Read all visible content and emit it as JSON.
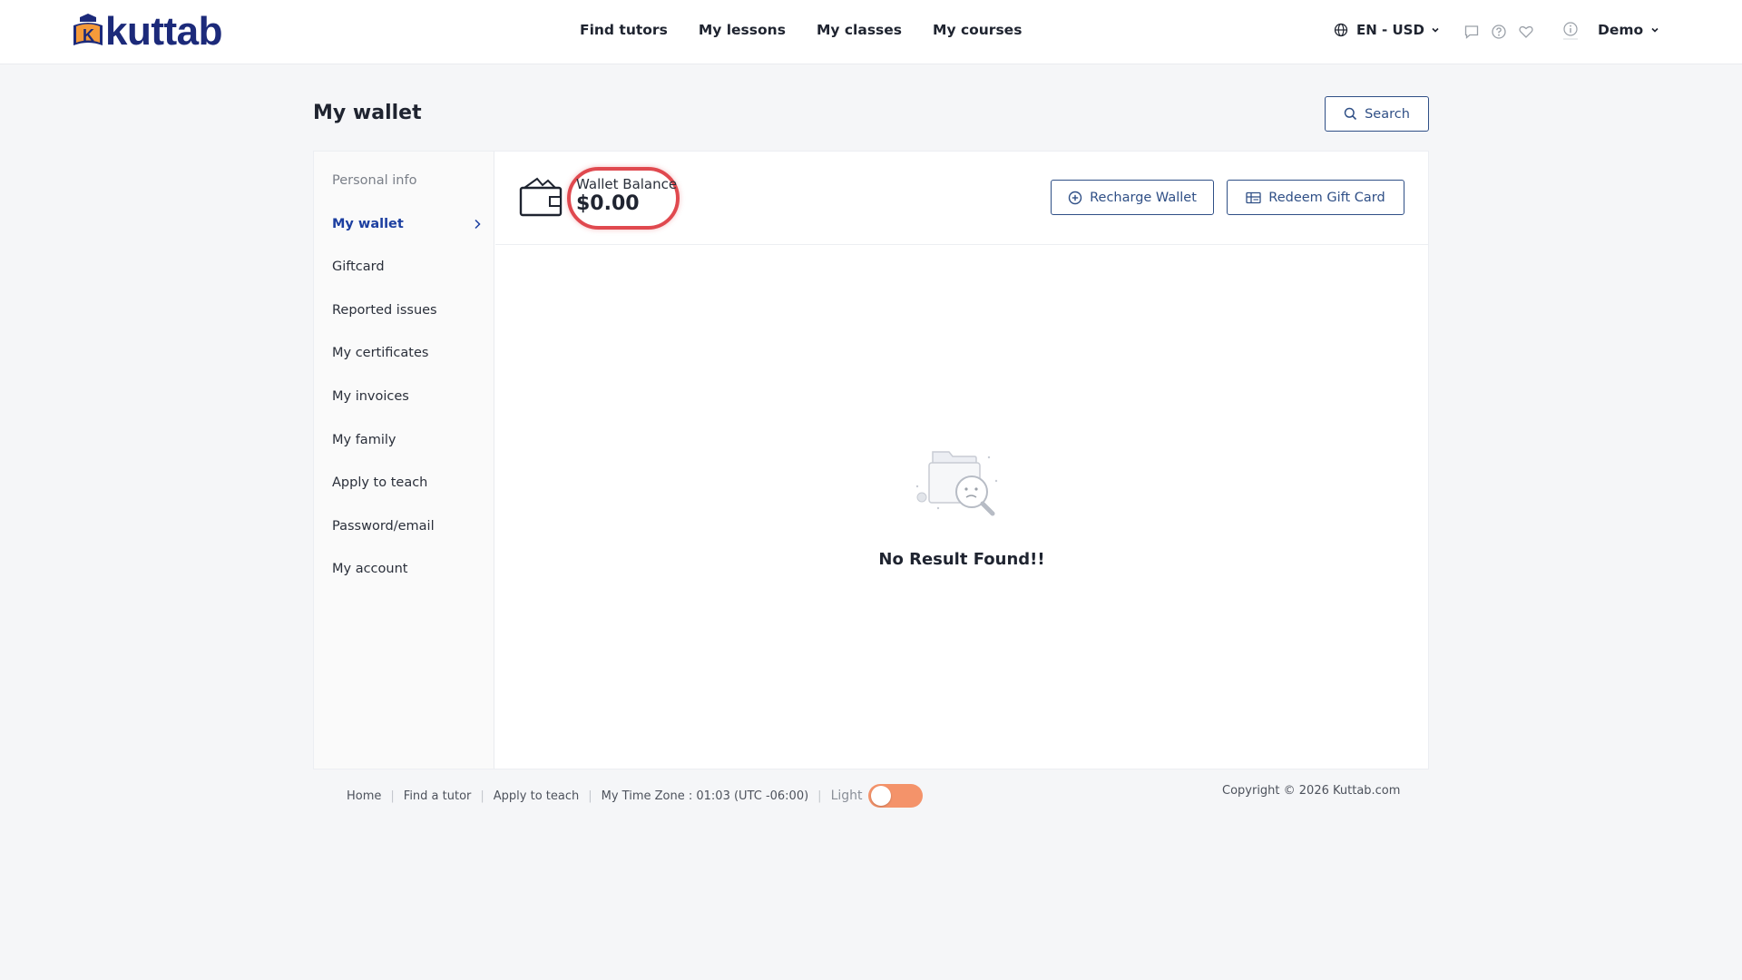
{
  "header": {
    "logo_text": "kuttab",
    "logo_letter": "K",
    "nav": [
      "Find tutors",
      "My lessons",
      "My classes",
      "My courses"
    ],
    "language_currency": "EN - USD",
    "user_name": "Demo"
  },
  "page": {
    "title": "My wallet",
    "search_label": "Search"
  },
  "sidebar": {
    "items": [
      {
        "label": "Personal info",
        "state": "muted"
      },
      {
        "label": "My wallet",
        "state": "active"
      },
      {
        "label": "Giftcard"
      },
      {
        "label": "Reported issues"
      },
      {
        "label": "My certificates"
      },
      {
        "label": "My invoices"
      },
      {
        "label": "My family"
      },
      {
        "label": "Apply to teach"
      },
      {
        "label": "Password/email"
      },
      {
        "label": "My account"
      }
    ]
  },
  "wallet": {
    "balance_label": "Wallet Balance",
    "balance_value": "$0.00",
    "recharge_label": "Recharge Wallet",
    "redeem_label": "Redeem Gift Card",
    "empty_text": "No Result Found!!"
  },
  "footer": {
    "links": [
      "Home",
      "Find a tutor",
      "Apply to teach"
    ],
    "timezone": "My Time Zone : 01:03 (UTC -06:00)",
    "theme_label": "Light",
    "copyright": "Copyright © 2026 Kuttab.com"
  },
  "colors": {
    "brand_navy": "#1c2a7a",
    "accent_blue": "#2f4f86",
    "active_link": "#1c3fa0",
    "highlight_red": "#e0494f",
    "toggle_orange": "#f4936a"
  }
}
